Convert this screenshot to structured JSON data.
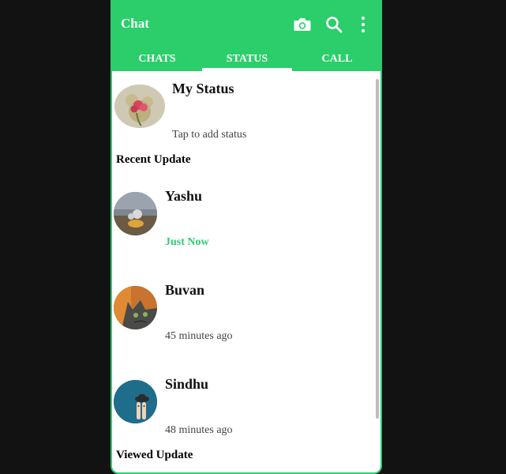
{
  "app": {
    "title": "Chat"
  },
  "toolbar": {
    "icons": [
      "camera-icon",
      "search-icon",
      "more-vertical-icon"
    ]
  },
  "tabs": [
    {
      "label": "CHATS",
      "active": false
    },
    {
      "label": "STATUS",
      "active": true
    },
    {
      "label": "CALL",
      "active": false
    }
  ],
  "my_status": {
    "title": "My Status",
    "hint": "Tap to add status"
  },
  "recent_header": "Recent Update",
  "statuses": [
    {
      "name": "Yashu",
      "time": "Just Now"
    },
    {
      "name": "Buvan",
      "time": "45 minutes ago"
    },
    {
      "name": "Sindhu",
      "time": "48 minutes ago"
    }
  ],
  "viewed_header": "Viewed Update",
  "colors": {
    "accent": "#2bce6a",
    "background": "#121212",
    "fresh_time": "#2ecc71"
  }
}
